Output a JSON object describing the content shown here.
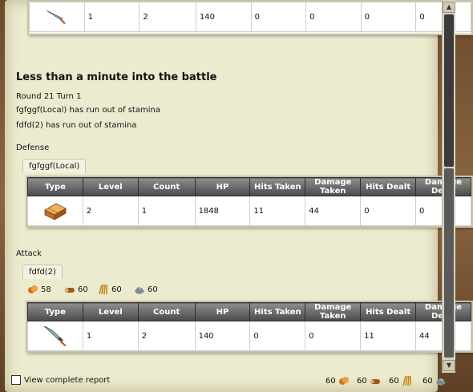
{
  "top_row": {
    "level": "1",
    "count": "2",
    "hp": "140",
    "hits_taken": "0",
    "damage_taken": "0",
    "hits_dealt": "0",
    "damage_dealt": "0"
  },
  "battle": {
    "title": "Less than a minute into the battle",
    "round": "Round 21 Turn 1",
    "log": [
      "fgfggf(Local) has run out of stamina",
      "fdfd(2) has run out of stamina"
    ]
  },
  "headers": {
    "type": "Type",
    "level": "Level",
    "count": "Count",
    "hp": "HP",
    "hits_taken": "Hits Taken",
    "damage_taken": "Damage Taken",
    "hits_dealt": "Hits Dealt",
    "damage_dealt": "Damage Dealt"
  },
  "defense": {
    "label": "Defense",
    "tab": "fgfggf(Local)",
    "row": {
      "level": "2",
      "count": "1",
      "hp": "1848",
      "hits_taken": "11",
      "damage_taken": "44",
      "hits_dealt": "0",
      "damage_dealt": "0"
    }
  },
  "attack": {
    "label": "Attack",
    "tab": "fdfd(2)",
    "resources": [
      "58",
      "60",
      "60",
      "60"
    ],
    "row": {
      "level": "1",
      "count": "2",
      "hp": "140",
      "hits_taken": "0",
      "damage_taken": "0",
      "hits_dealt": "11",
      "damage_dealt": "44"
    }
  },
  "footer": {
    "view_report": "View complete report",
    "resources": [
      "60",
      "60",
      "60",
      "60"
    ]
  }
}
